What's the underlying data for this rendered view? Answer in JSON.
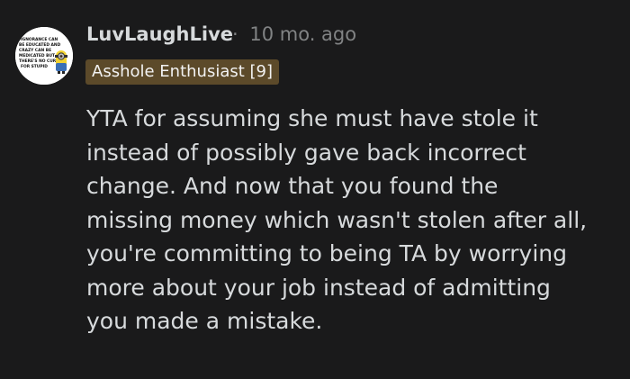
{
  "comment": {
    "username": "LuvLaughLive",
    "separator": "·",
    "timestamp": "10 mo. ago",
    "flair": "Asshole Enthusiast [9]",
    "body_lines": [
      "YTA for assuming she must have stole it",
      "instead of possibly gave back incorrect",
      "change. And now that you found the",
      "missing money which wasn't stolen after all,",
      "you're committing to being TA by worrying",
      "more about your job instead of admitting",
      "you made a mistake."
    ],
    "avatar": {
      "icon": "minion-meme-avatar",
      "text_lines": [
        "IGNORANCE CAN",
        "BE EDUCATED AND",
        "CRAZY CAN BE",
        "MEDICATED BUT",
        "THERE'S NO CURE",
        "FOR STUPID"
      ]
    }
  },
  "colors": {
    "background": "#1a1a1b",
    "text": "#d7dadc",
    "muted": "#818384",
    "flair_bg": "#5c4a2a"
  }
}
